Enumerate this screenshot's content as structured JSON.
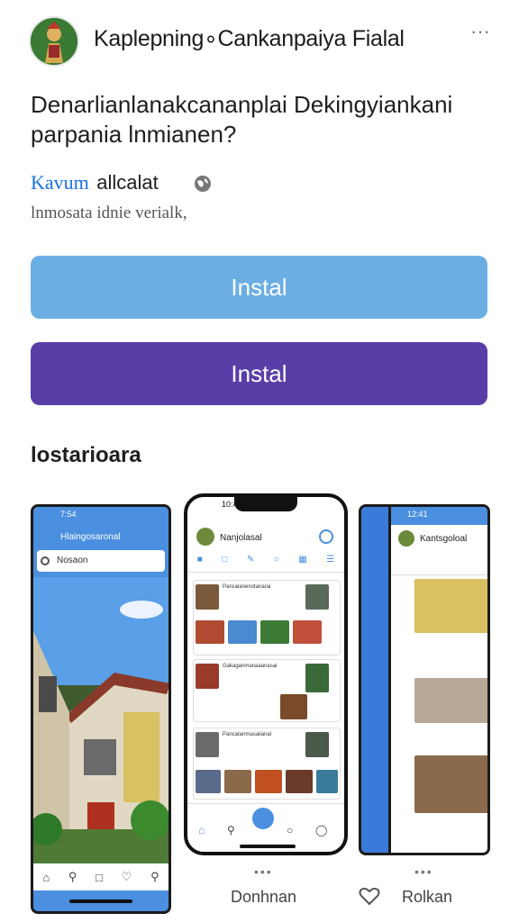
{
  "app": {
    "title": "Kaplepning∘Cankanpaiya Fialal"
  },
  "question": "Denarlianlanakcananplai Dekingyiankani parpania lnmianen?",
  "subtitle": {
    "highlight": "Kavum",
    "rest": "allcalat"
  },
  "caption": "lnmosata idnie verialk,",
  "buttons": {
    "primary_label": "Instal",
    "secondary_label": "Instal"
  },
  "screenshots_section": {
    "title": "lostarioara",
    "left": {
      "status_time": "7:54",
      "title": "Hlaingosaronal",
      "search_placeholder": "Nosaon"
    },
    "middle": {
      "status_time": "10:41",
      "header_title": "Nanjolasal",
      "rows": [
        "Pancalanenotanarai",
        "Gakaganmanaaanasai",
        "Pancatanmasaiianal"
      ]
    },
    "right": {
      "status_time": "12:41",
      "header_title": "Kantsgoloal"
    }
  },
  "footer": {
    "left_label": "Donhnan",
    "right_label": "Rolkan"
  },
  "colors": {
    "primary_button": "#6aaee4",
    "secondary_button": "#5a3ea8",
    "link": "#1a73e8"
  }
}
